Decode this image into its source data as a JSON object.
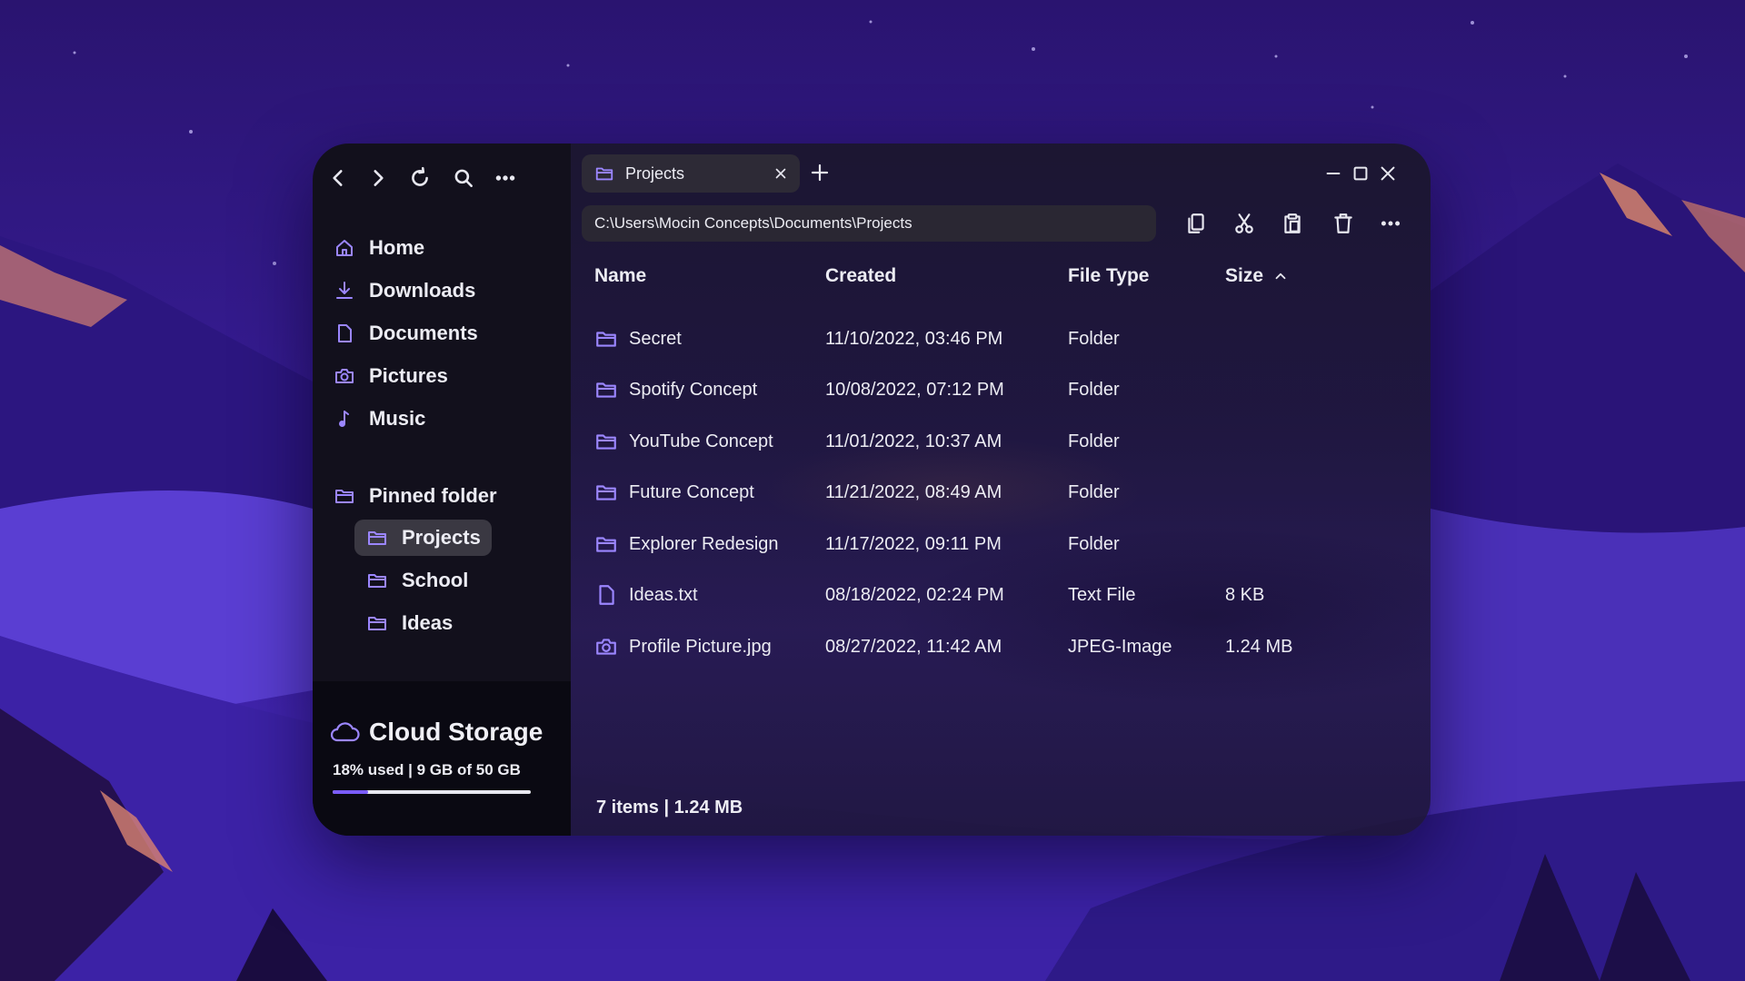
{
  "nav": {
    "back_icon": "chevron-left-icon",
    "forward_icon": "chevron-right-icon",
    "refresh_icon": "refresh-icon",
    "search_icon": "search-icon",
    "more_icon": "more-horizontal-icon"
  },
  "sidebar": {
    "items": [
      {
        "label": "Home",
        "icon": "home-icon"
      },
      {
        "label": "Downloads",
        "icon": "download-icon"
      },
      {
        "label": "Documents",
        "icon": "document-icon"
      },
      {
        "label": "Pictures",
        "icon": "camera-icon"
      },
      {
        "label": "Music",
        "icon": "music-note-icon"
      }
    ],
    "pinned": {
      "label": "Pinned folder",
      "items": [
        {
          "label": "Projects",
          "active": true
        },
        {
          "label": "School"
        },
        {
          "label": "Ideas"
        }
      ]
    }
  },
  "cloud": {
    "title": "Cloud Storage",
    "usage": "18% used | 9 GB of 50 GB",
    "used_fraction": 0.18,
    "accent": "#7b5cff"
  },
  "tab": {
    "label": "Projects"
  },
  "address": {
    "path": "C:\\Users\\Mocin Concepts\\Documents\\Projects"
  },
  "columns": {
    "name": "Name",
    "created": "Created",
    "type": "File Type",
    "size": "Size"
  },
  "files": [
    {
      "name": "Secret",
      "created": "11/10/2022, 03:46 PM",
      "type": "Folder",
      "size": "",
      "icon": "folder-icon"
    },
    {
      "name": "Spotify Concept",
      "created": "10/08/2022, 07:12 PM",
      "type": "Folder",
      "size": "",
      "icon": "folder-icon"
    },
    {
      "name": "YouTube Concept",
      "created": "11/01/2022, 10:37 AM",
      "type": "Folder",
      "size": "",
      "icon": "folder-icon"
    },
    {
      "name": "Future Concept",
      "created": "11/21/2022, 08:49 AM",
      "type": "Folder",
      "size": "",
      "icon": "folder-icon"
    },
    {
      "name": "Explorer Redesign",
      "created": "11/17/2022, 09:11 PM",
      "type": "Folder",
      "size": "",
      "icon": "folder-icon"
    },
    {
      "name": "Ideas.txt",
      "created": "08/18/2022, 02:24 PM",
      "type": "Text File",
      "size": "8 KB",
      "icon": "file-icon"
    },
    {
      "name": "Profile Picture.jpg",
      "created": "08/27/2022, 11:42 AM",
      "type": "JPEG-Image",
      "size": "1.24 MB",
      "icon": "image-icon"
    }
  ],
  "status": "7 items | 1.24 MB",
  "colors": {
    "accent_icon": "#9b86ff",
    "sidebar_bg": "#12101c",
    "cloud_bg": "#0a0912"
  }
}
